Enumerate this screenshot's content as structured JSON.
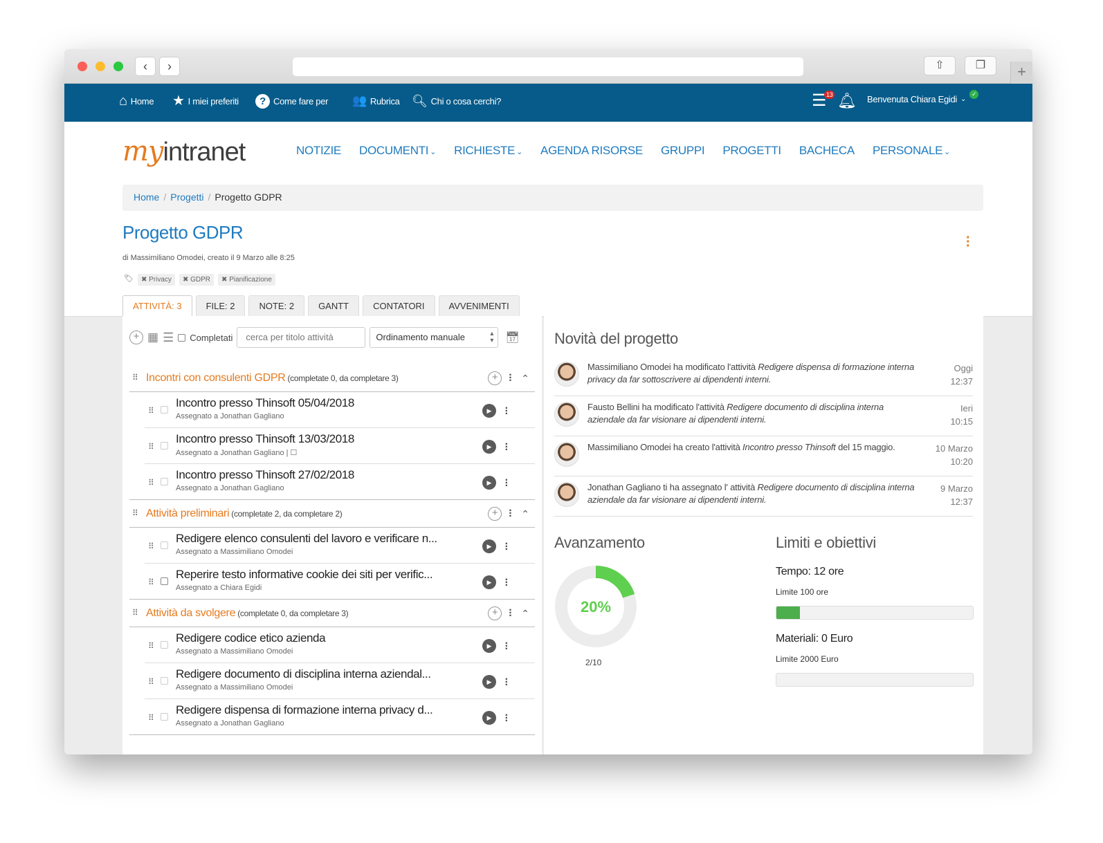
{
  "topbar": {
    "home": "Home",
    "favorites": "I miei preferiti",
    "howto": "Come fare per",
    "rubrica": "Rubrica",
    "search": "Chi o cosa cerchi?",
    "tasks_badge": "13",
    "welcome": "Benvenuta Chiara Egidi"
  },
  "logo": {
    "my": "my",
    "text": "intranet"
  },
  "mainnav": {
    "notizie": "NOTIZIE",
    "documenti": "DOCUMENTI",
    "richieste": "RICHIESTE",
    "agenda": "AGENDA RISORSE",
    "gruppi": "GRUPPI",
    "progetti": "PROGETTI",
    "bacheca": "BACHECA",
    "personale": "PERSONALE"
  },
  "breadcrumb": {
    "home": "Home",
    "progetti": "Progetti",
    "current": "Progetto GDPR"
  },
  "project": {
    "title": "Progetto GDPR",
    "subtitle": "di Massimiliano Omodei, creato il 9 Marzo alle 8:25",
    "tags": [
      "Privacy",
      "GDPR",
      "Pianificazione"
    ]
  },
  "tabs": [
    "ATTIVITÀ: 3",
    "FILE: 2",
    "NOTE: 2",
    "GANTT",
    "CONTATORI",
    "AVVENIMENTI"
  ],
  "toolbar": {
    "completed_label": "Completati",
    "search_placeholder": "cerca per titolo attività",
    "sort_value": "Ordinamento manuale"
  },
  "groups": [
    {
      "title": "Incontri con consulenti GDPR",
      "counts": "(completate 0, da completare 3)",
      "tasks": [
        {
          "title": "Incontro presso Thinsoft 05/04/2018",
          "assignee": "Assegnato a Jonathan Gagliano"
        },
        {
          "title": "Incontro presso Thinsoft 13/03/2018",
          "assignee": "Assegnato a Jonathan Gagliano | ☐"
        },
        {
          "title": "Incontro presso Thinsoft 27/02/2018",
          "assignee": "Assegnato a Jonathan Gagliano"
        }
      ]
    },
    {
      "title": "Attività preliminari",
      "counts": "(completate 2, da completare 2)",
      "tasks": [
        {
          "title": "Redigere elenco consulenti del lavoro e verificare n...",
          "assignee": "Assegnato a Massimiliano Omodei"
        },
        {
          "title": "Reperire testo informative cookie dei siti per verific...",
          "assignee": "Assegnato a Chiara Egidi"
        }
      ]
    },
    {
      "title": "Attività da svolgere",
      "counts": "(completate 0, da completare 3)",
      "tasks": [
        {
          "title": "Redigere codice etico azienda",
          "assignee": "Assegnato a Massimiliano Omodei"
        },
        {
          "title": "Redigere documento di disciplina interna aziendal...",
          "assignee": "Assegnato a Massimiliano Omodei"
        },
        {
          "title": "Redigere dispensa di formazione interna privacy d...",
          "assignee": "Assegnato a Jonathan Gagliano"
        }
      ]
    }
  ],
  "news": {
    "title": "Novità del progetto",
    "items": [
      {
        "text": "Massimiliano Omodei ha modificato l'attività ",
        "italic": "Redigere dispensa di formazione interna privacy da far sottoscrivere ai dipendenti interni.",
        "tail": "",
        "date": "Oggi",
        "time": "12:37"
      },
      {
        "text": "Fausto Bellini ha modificato l'attività ",
        "italic": "Redigere documento di disciplina interna aziendale da far visionare ai dipendenti interni.",
        "tail": "",
        "date": "Ieri",
        "time": "10:15"
      },
      {
        "text": "Massimiliano Omodei ha creato l'attività ",
        "italic": "Incontro presso Thinsoft",
        "tail": " del 15 maggio.",
        "date": "10 Marzo",
        "time": "10:20"
      },
      {
        "text": "Jonathan Gagliano ti ha assegnato l' attività ",
        "italic": "Redigere documento di disciplina interna aziendale da far visionare ai dipendenti interni.",
        "tail": "",
        "date": "9 Marzo",
        "time": "12:37"
      }
    ]
  },
  "progress": {
    "title": "Avanzamento",
    "percent_label": "20%",
    "percent": 20,
    "fraction": "2/10",
    "color": "#5fcf4f"
  },
  "limits": {
    "title": "Limiti e obiettivi",
    "time_label": "Tempo: 12 ore",
    "time_limit": "Limite 100 ore",
    "time_fill": 0.12,
    "materials_label": "Materiali: 0 Euro",
    "materials_limit": "Limite 2000 Euro",
    "materials_fill": 0
  },
  "colors": {
    "topbar": "#075b8a",
    "link": "#1f7bbf",
    "accent": "#e57b1f",
    "progress": "#4cae4c"
  }
}
